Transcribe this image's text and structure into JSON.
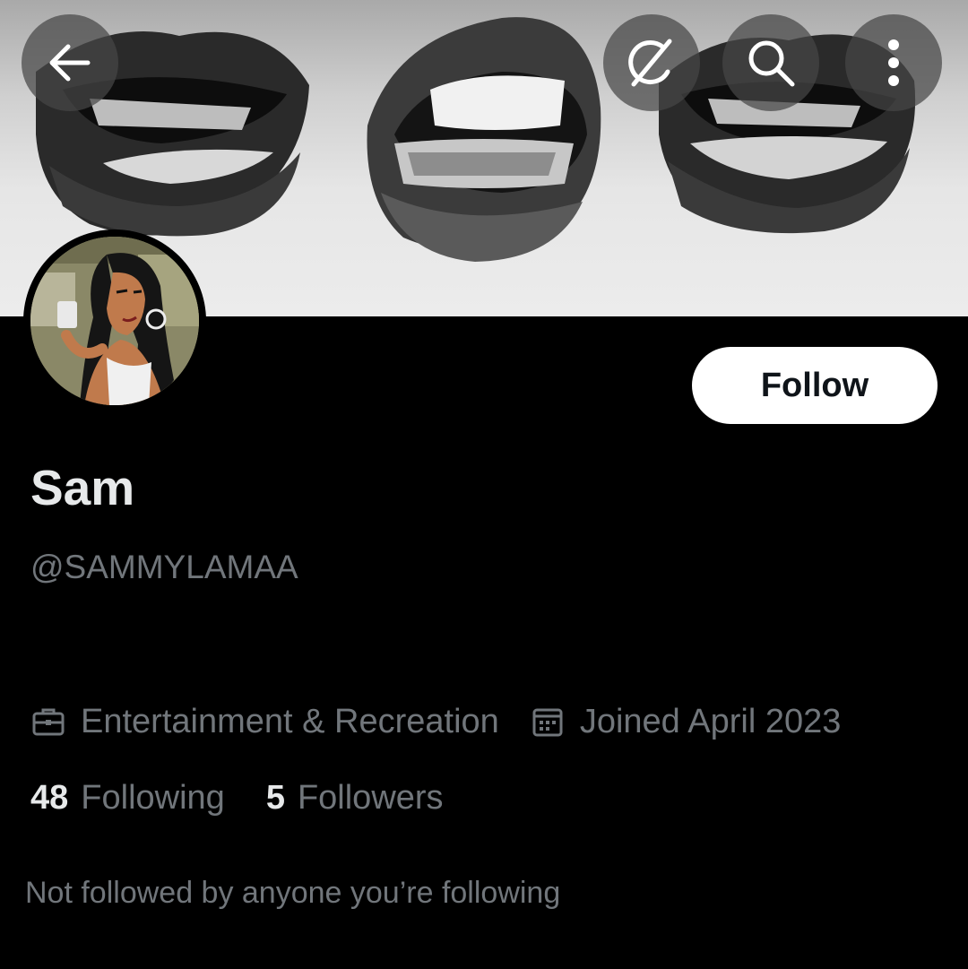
{
  "header": {
    "back_icon": "arrow-left-icon",
    "grok_icon": "grok-icon",
    "search_icon": "search-icon",
    "more_icon": "more-vertical-icon"
  },
  "profile": {
    "display_name": "Sam",
    "handle": "@SAMMYLAMAA",
    "category": "Entertainment & Recreation",
    "joined": "Joined April 2023",
    "following_count": "48",
    "following_label": "Following",
    "followers_count": "5",
    "followers_label": "Followers",
    "followed_by_text": "Not followed by anyone you’re following"
  },
  "actions": {
    "follow_label": "Follow"
  },
  "colors": {
    "background": "#000000",
    "primary_text": "#e7e9ea",
    "secondary_text": "#71767b",
    "follow_button_bg": "#ffffff",
    "follow_button_text": "#0f1419"
  }
}
